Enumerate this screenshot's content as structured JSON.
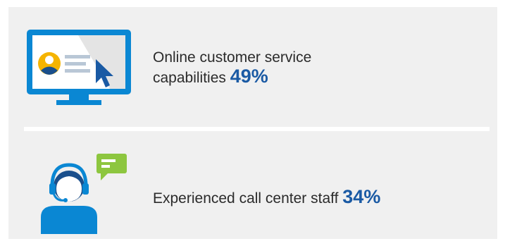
{
  "colors": {
    "background": "#f0f0f0",
    "accent_blue": "#0a87d3",
    "stat_blue": "#1a5aa4",
    "speech_green": "#8dc63f",
    "divider": "#ffffff"
  },
  "items": [
    {
      "icon": "monitor-cursor-icon",
      "label": "Online customer service capabilities",
      "value": "49%"
    },
    {
      "icon": "call-center-agent-icon",
      "label": "Experienced call center staff",
      "value": "34%"
    }
  ]
}
